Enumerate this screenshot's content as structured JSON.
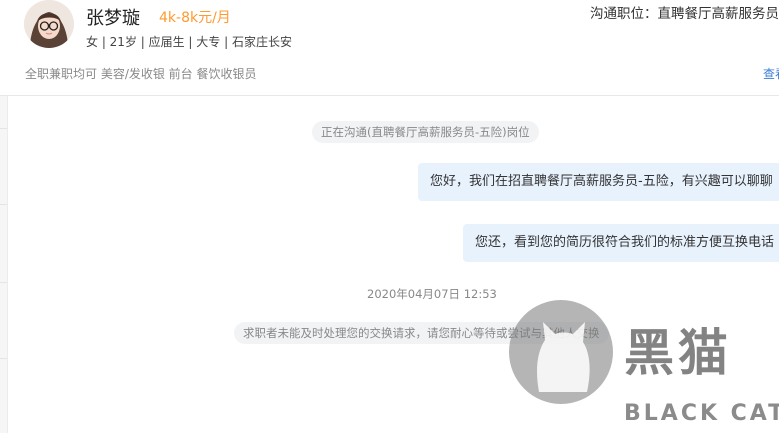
{
  "candidate": {
    "name": "张梦璇",
    "salary": "4k-8k元/月",
    "meta": "女 | 21岁 | 应届生 | 大专 | 石家庄长安",
    "tags": "全职兼职均可 美容/发收银 前台 餐饮收银员",
    "view_link": "查看"
  },
  "position": "沟通职位：直聘餐厅高薪服务员",
  "chat": {
    "system_notice": "正在沟通(直聘餐厅高薪服务员-五险)岗位",
    "messages": [
      "您好，我们在招直聘餐厅高薪服务员-五险，有兴趣可以聊聊",
      "您还，看到您的简历很符合我们的标准方便互换电话"
    ],
    "timestamp": "2020年04月07日 12:53",
    "exchange_notice": "求职者未能及时处理您的交换请求，请您耐心等待或尝试与其他人交换"
  },
  "watermark": {
    "logo_text": "黑猫",
    "logo_sub": "BLACK CAT"
  }
}
